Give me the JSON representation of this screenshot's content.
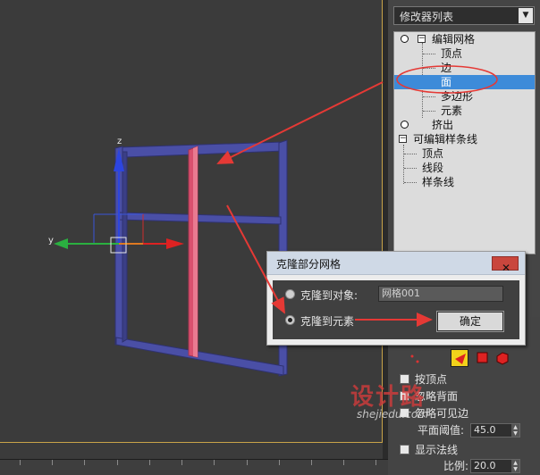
{
  "viewport": {
    "axis_labels": {
      "z": "z",
      "y": "y"
    }
  },
  "command_panel": {
    "modifier_list": {
      "selected": "修改器列表"
    },
    "stack": [
      {
        "label": "编辑网格",
        "level": 0,
        "icon": "lightbulb-icon"
      },
      {
        "label": "顶点",
        "level": 1
      },
      {
        "label": "边",
        "level": 1
      },
      {
        "label": "面",
        "level": 1,
        "selected": true
      },
      {
        "label": "多边形",
        "level": 1
      },
      {
        "label": "元素",
        "level": 1
      },
      {
        "label": "挤出",
        "level": 0,
        "icon": "lightbulb-icon"
      },
      {
        "label": "可编辑样条线",
        "level": 0
      },
      {
        "label": "顶点",
        "level": 1
      },
      {
        "label": "线段",
        "level": 1
      },
      {
        "label": "样条线",
        "level": 1
      }
    ],
    "options": {
      "by_vertex": "按顶点",
      "ignore_backfacing": "忽略背面",
      "by_angle_edges": "忽略可见边",
      "planar_threshold_label": "平面阈值:",
      "planar_threshold_value": "45.0",
      "show_normals": "显示法线",
      "scale_label": "比例:",
      "scale_value": "20.0"
    }
  },
  "dialog": {
    "title": "克隆部分网格",
    "close": "✕",
    "option_object": "克隆到对象:",
    "object_name": "网格001",
    "option_element": "克隆到元素",
    "selected_option": "克隆到元素",
    "ok": "确定"
  },
  "watermark": {
    "big": "设计路",
    "small": "shejiedu.com"
  },
  "colors": {
    "accent_selection": "#3d8bd9",
    "annotation_red": "#e53935",
    "mesh_blue": "#4a4fa6",
    "mesh_pink": "#d9506e",
    "viewport_bg": "#3b3b3b"
  }
}
